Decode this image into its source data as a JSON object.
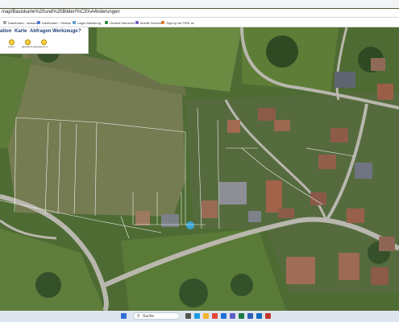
{
  "browser": {
    "url": "map/Basiskarte%20und%20Bilder/%C3%A4nderungen"
  },
  "bookmarks": [
    {
      "icon": "bookmark-icon",
      "label": "Dashboard - tanssch",
      "color": "#9aa0a6"
    },
    {
      "icon": "bookmark-icon",
      "label": "Dashboard - Stratus",
      "color": "#4a7bd0"
    },
    {
      "icon": "bookmark-icon",
      "label": "Lager Abbildung",
      "color": "#5aa0d8"
    },
    {
      "icon": "bookmark-icon",
      "label": "Geokat Übersicht",
      "color": "#3a8a3a"
    },
    {
      "icon": "bookmark-icon",
      "label": "Mobile Service",
      "color": "#7a5ac8"
    },
    {
      "icon": "bookmark-icon",
      "label": "Sign up for FIRE ac",
      "color": "#e07a2a"
    }
  ],
  "ribbon": {
    "tabs": [
      "ation",
      "Karte",
      "Abfragen",
      "Werkzeuge",
      "?"
    ],
    "tools": [
      "Zoom",
      "aktuelle Position",
      "Zoom in"
    ]
  },
  "taskbar": {
    "search_placeholder": "Suche",
    "icons": [
      {
        "name": "start-icon",
        "color": "#2f6fd6"
      },
      {
        "name": "search-taskbar-icon",
        "color": "#777777"
      },
      {
        "name": "task-view-icon",
        "color": "#555555"
      },
      {
        "name": "edge-browser-icon",
        "color": "#1e9be0"
      },
      {
        "name": "file-explorer-icon",
        "color": "#f1b52b"
      },
      {
        "name": "chrome-browser-icon",
        "color": "#e2483d"
      },
      {
        "name": "mail-icon",
        "color": "#1e6fd6"
      },
      {
        "name": "teams-icon",
        "color": "#5b5fc7"
      },
      {
        "name": "excel-icon",
        "color": "#1d7b45"
      },
      {
        "name": "word-icon",
        "color": "#2b5fb8"
      },
      {
        "name": "outlook-icon",
        "color": "#0f6cbd"
      },
      {
        "name": "app-icon",
        "color": "#c0392b"
      }
    ]
  },
  "colors": {
    "field": "#7b8257",
    "field_dark": "#5f6a3e",
    "road": "#b9b7ae",
    "parcel_line": "#ffffff",
    "accent": "#1f3e74"
  }
}
